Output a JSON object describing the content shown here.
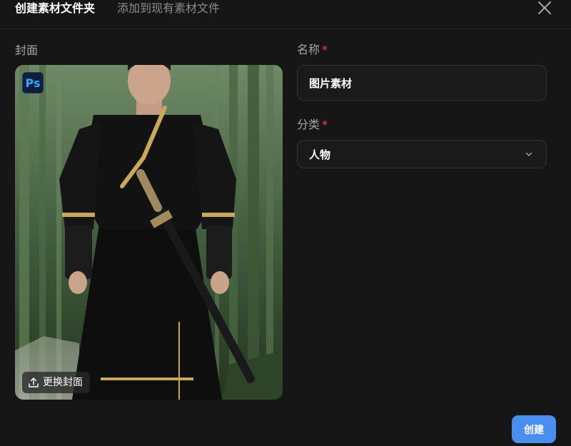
{
  "header": {
    "tab_create": "创建素材文件夹",
    "tab_add_existing": "添加到现有素材文件"
  },
  "form": {
    "cover_label": "封面",
    "cover_app_badge": "Ps",
    "cover_replace_label": "更换封面",
    "name_label": "名称",
    "name_value": "图片素材",
    "category_label": "分类",
    "category_value": "人物",
    "required_mark": "*"
  },
  "footer": {
    "create_label": "创建"
  },
  "colors": {
    "background": "#161616",
    "accent": "#4a8ef0",
    "required": "#f5453d"
  },
  "icons": {
    "close": "close-icon",
    "upload": "upload-icon",
    "chevron": "chevron-down-icon",
    "app_badge": "photoshop-icon"
  }
}
